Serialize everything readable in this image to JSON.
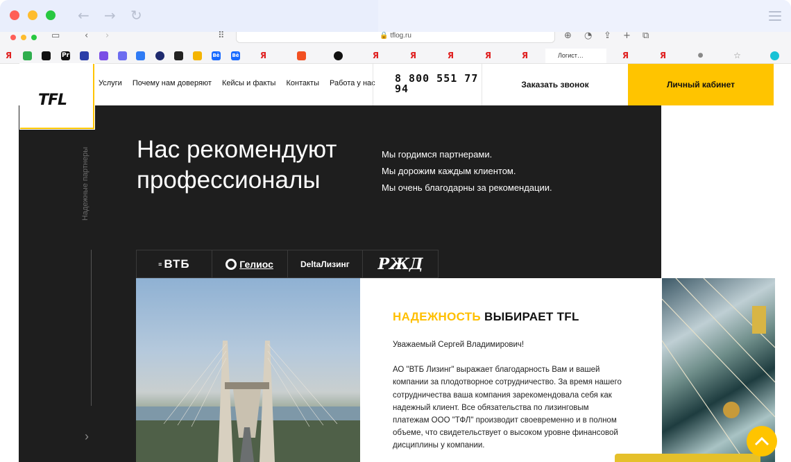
{
  "browser": {
    "url": "tflog.ru",
    "active_tab": "Логист…",
    "bookmark_labels": [
      "Я",
      "Pr",
      "Bē",
      "Bē",
      "Я",
      "Я",
      "Я",
      "Я",
      "Я",
      "Я",
      "Я"
    ]
  },
  "header": {
    "logo": "TFL",
    "nav": [
      "Услуги",
      "Почему нам доверяют",
      "Кейсы и факты",
      "Контакты",
      "Работа у нас"
    ],
    "phone_line1": "8 800 551 77",
    "phone_line2": "94",
    "callback": "Заказать звонок",
    "cabinet": "Личный кабинет"
  },
  "hero": {
    "side_label": "Надежные партнеры",
    "title_line1": "Нас рекомендуют",
    "title_line2": "профессионалы",
    "text": [
      "Мы гордимся партнерами.",
      "Мы дорожим каждым клиентом.",
      "Мы очень благодарны за рекомендации."
    ]
  },
  "partners": [
    "ВТБ",
    "Гелиос",
    "DeltaЛизинг",
    "РЖД"
  ],
  "card": {
    "title_highlight": "НАДЕЖНОСТЬ",
    "title_rest": " ВЫБИРАЕТ TFL",
    "greeting": "Уважаемый Сергей Владимирович!",
    "body": "АО \"ВТБ Лизинг\" выражает благодарность Вам и вашей компании за плодотворное сотрудничество. За время нашего сотрудничества ваша компания зарекомендовала себя как надежный клиент. Все обязательства по лизинговым платежам ООО \"ТФЛ\" производит своевременно и в полном объеме, что свидетельствует о высоком уровне финансовой дисциплины у компании."
  },
  "colors": {
    "accent": "#ffc400",
    "dark": "#1e1e1e"
  }
}
